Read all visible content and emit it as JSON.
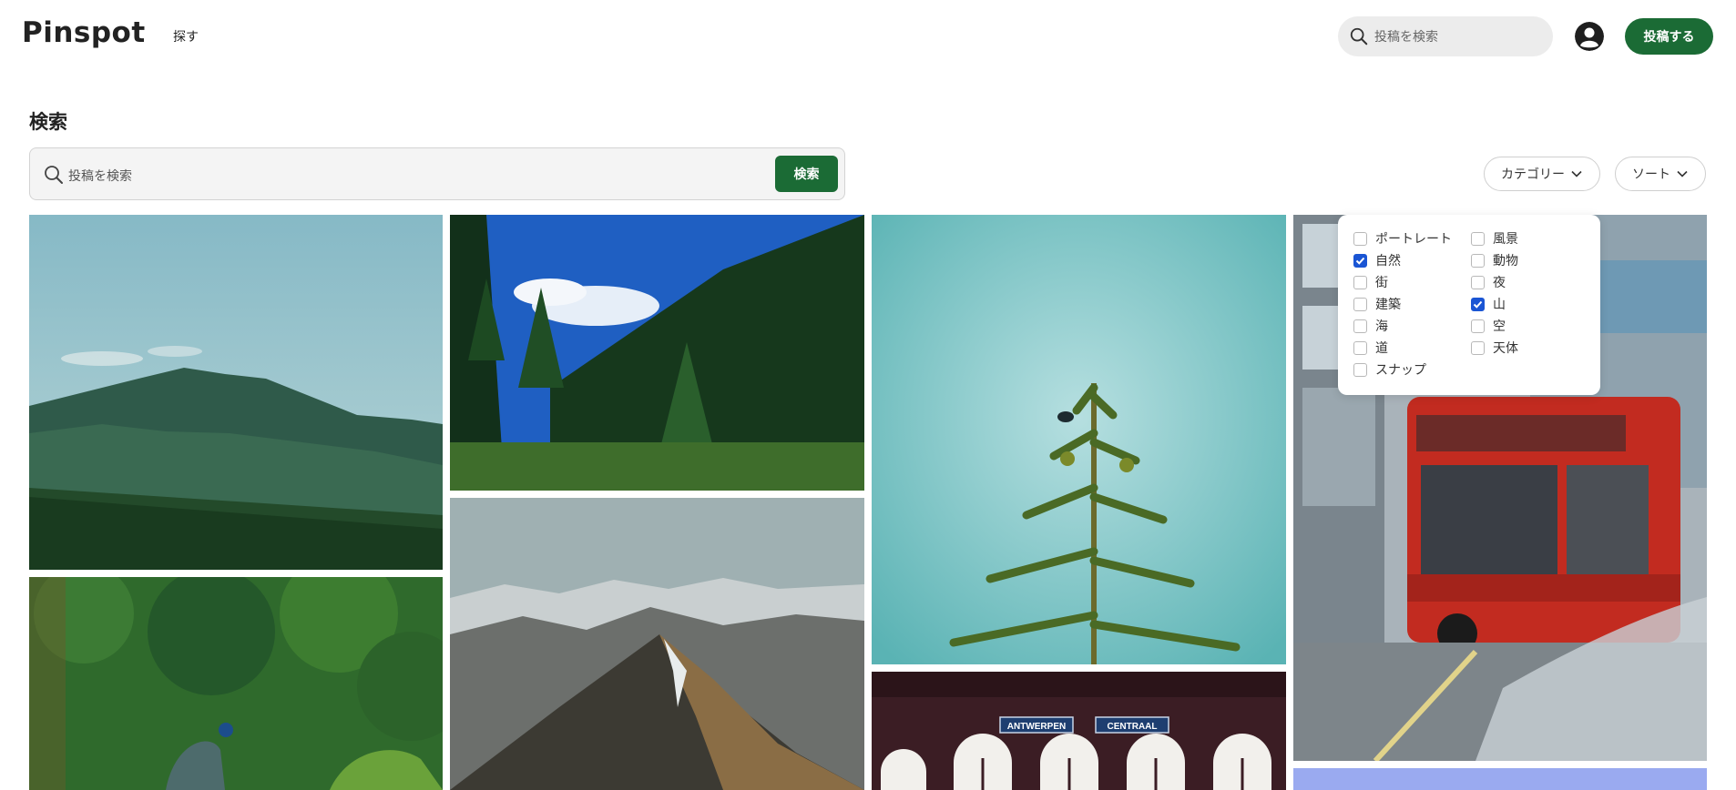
{
  "header": {
    "logo": "Pinspot",
    "nav_explore": "探す",
    "search_placeholder": "投稿を検索",
    "post_button": "投稿する"
  },
  "page": {
    "title": "検索"
  },
  "search": {
    "placeholder": "投稿を検索",
    "button": "検索"
  },
  "filters": {
    "category_label": "カテゴリー",
    "sort_label": "ソート"
  },
  "categories": [
    {
      "label": "ポートレート",
      "checked": false
    },
    {
      "label": "風景",
      "checked": false
    },
    {
      "label": "自然",
      "checked": true
    },
    {
      "label": "動物",
      "checked": false
    },
    {
      "label": "街",
      "checked": false
    },
    {
      "label": "夜",
      "checked": false
    },
    {
      "label": "建築",
      "checked": false
    },
    {
      "label": "山",
      "checked": true
    },
    {
      "label": "海",
      "checked": false
    },
    {
      "label": "空",
      "checked": false
    },
    {
      "label": "道",
      "checked": false
    },
    {
      "label": "天体",
      "checked": false
    },
    {
      "label": "スナップ",
      "checked": false
    }
  ],
  "station_signs": [
    "ANTWERPEN",
    "CENTRAAL"
  ],
  "colors": {
    "accent": "#1b6b35",
    "checkbox_checked": "#1a55d4"
  }
}
